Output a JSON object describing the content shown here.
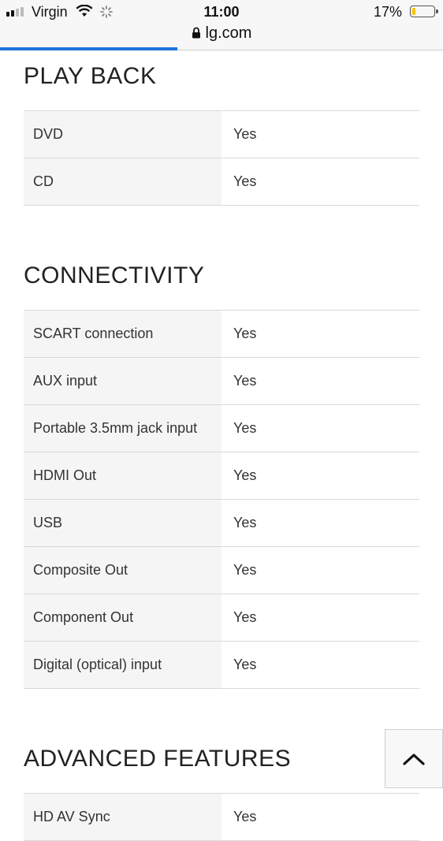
{
  "status_bar": {
    "carrier": "Virgin",
    "time": "11:00",
    "battery": "17%",
    "battery_level": 0.17,
    "signal_bars": 2
  },
  "browser": {
    "url": "lg.com",
    "load_progress": 0.4
  },
  "colors": {
    "progress": "#1f73dd",
    "battery_fill": "#f5c400"
  },
  "sections": [
    {
      "title": "PLAY BACK",
      "rows": [
        {
          "label": "DVD",
          "value": "Yes"
        },
        {
          "label": "CD",
          "value": "Yes"
        }
      ]
    },
    {
      "title": "CONNECTIVITY",
      "rows": [
        {
          "label": "SCART connection",
          "value": "Yes"
        },
        {
          "label": "AUX input",
          "value": "Yes"
        },
        {
          "label": "Portable 3.5mm jack input",
          "value": "Yes"
        },
        {
          "label": "HDMI Out",
          "value": "Yes"
        },
        {
          "label": "USB",
          "value": "Yes"
        },
        {
          "label": "Composite Out",
          "value": "Yes"
        },
        {
          "label": "Component Out",
          "value": "Yes"
        },
        {
          "label": "Digital (optical) input",
          "value": "Yes"
        }
      ]
    },
    {
      "title": "ADVANCED FEATURES",
      "rows": [
        {
          "label": "HD AV Sync",
          "value": "Yes"
        }
      ]
    }
  ],
  "icons": {
    "back_to_top": "chevron-up-icon",
    "lock": "lock-icon",
    "wifi": "wifi-icon"
  }
}
